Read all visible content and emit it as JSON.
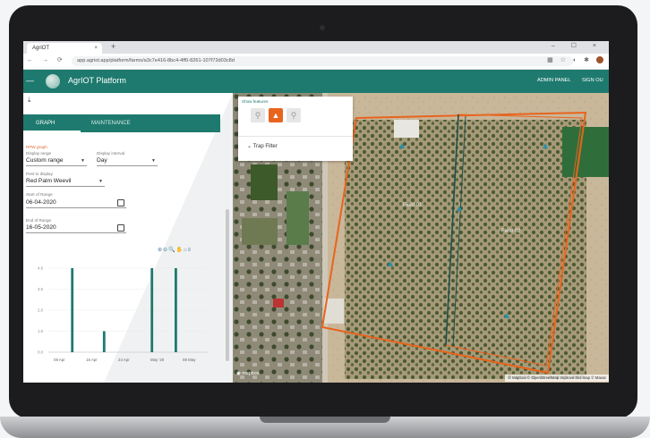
{
  "browser": {
    "tab_title": "AgriOT",
    "tab_close": "×",
    "new_tab": "+",
    "window_controls": "–  ☐  ×",
    "nav_buttons": "←  →  ⟳",
    "url": "app.agriot.app/platform/farms/a3c7e416-8bc4-4ff0-8261-107f72d03c8d"
  },
  "header": {
    "title": "AgrIOT Platform",
    "admin_panel": "ADMIN PANEL",
    "sign_out": "SIGN OU"
  },
  "panel": {
    "tabs": [
      {
        "label": "GRAPH"
      },
      {
        "label": "MAINTENANCE"
      }
    ],
    "section_label": "RPW graph",
    "display_range": {
      "label": "Display range",
      "value": "Custom range"
    },
    "display_interval": {
      "label": "Display interval",
      "value": "Day"
    },
    "pest": {
      "label": "Pest to display",
      "value": "Red Palm Weevil"
    },
    "start": {
      "label": "Start of Range",
      "value": "06-04-2020"
    },
    "end": {
      "label": "End of Range",
      "value": "16-05-2020"
    },
    "chart_toolbar": "⊕⊖🔍✋⌂≡"
  },
  "chart_data": {
    "type": "bar",
    "color": "#1e7a6e",
    "x_start": "2020-04-06",
    "x_end": "2020-05-16",
    "xticks": [
      "08 Apr",
      "16 Apr",
      "24 Apr",
      "May '20",
      "08 May"
    ],
    "yticks": [
      "4.0",
      "3.0",
      "2.0",
      "1.0",
      "0.0"
    ],
    "ylim": [
      0,
      4
    ],
    "bars": [
      {
        "date": "2020-04-12",
        "value": 4
      },
      {
        "date": "2020-04-20",
        "value": 1
      },
      {
        "date": "2020-05-02",
        "value": 4
      },
      {
        "date": "2020-05-08",
        "value": 4
      }
    ]
  },
  "map": {
    "show_features_label": "Show features",
    "trap_filter": "Trap Filter",
    "field1_label": "Field 01",
    "field2_label": "Field 02",
    "mapbox_logo": "mapbox",
    "attribution": "© Mapbox © OpenStreetMap Improve this map © Maxar",
    "boundary_color": "#e8641e",
    "trap_color": "#2a8fa8"
  }
}
